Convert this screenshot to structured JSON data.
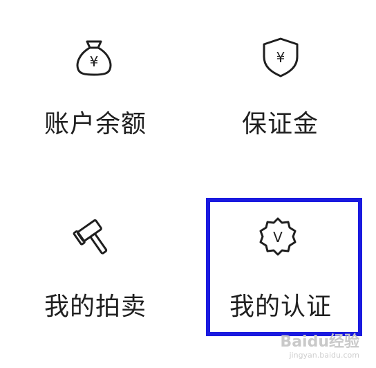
{
  "grid": {
    "items": [
      {
        "label": "账户余额",
        "icon": "money-bag-icon"
      },
      {
        "label": "保证金",
        "icon": "shield-yuan-icon"
      },
      {
        "label": "我的拍卖",
        "icon": "auction-hammer-icon"
      },
      {
        "label": "我的认证",
        "icon": "verified-badge-icon"
      }
    ],
    "icon_glyphs": {
      "yuan": "¥",
      "verified": "V"
    }
  },
  "highlight": {
    "target": "我的认证",
    "color": "#1a1adf"
  },
  "watermark": {
    "main": "Baidu经验",
    "sub": "jingyan.baidu.com"
  }
}
